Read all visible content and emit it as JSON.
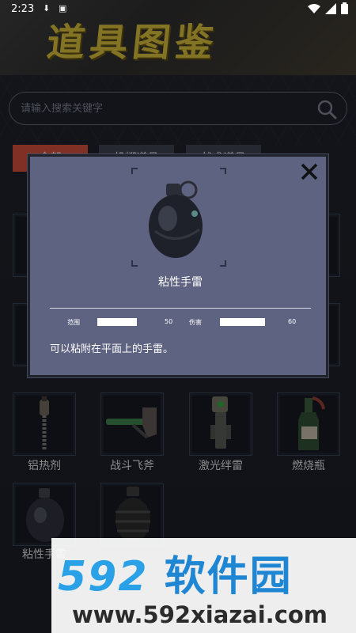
{
  "status_bar": {
    "time": "2:23"
  },
  "banner": {
    "title": "道具图鉴"
  },
  "search": {
    "placeholder": "请输入搜索关键字"
  },
  "tabs": [
    {
      "label": "全部"
    },
    {
      "label": "投掷道具"
    },
    {
      "label": "战术道具"
    }
  ],
  "grid": {
    "row3": [
      {
        "label": "铝热剂"
      },
      {
        "label": "战斗飞斧"
      },
      {
        "label": "激光绊雷"
      },
      {
        "label": "燃烧瓶"
      }
    ],
    "row4": [
      {
        "label": "粘性手雷"
      },
      {
        "label": ""
      }
    ]
  },
  "dialog": {
    "item_name": "粘性手雷",
    "stats": {
      "range_label": "范围",
      "range_value": "50",
      "damage_label": "伤害",
      "damage_value": "60",
      "range_fill": 0.5,
      "damage_fill": 0.6
    },
    "description": "可以粘附在平面上的手雷。"
  },
  "watermark": {
    "brand_number": "592",
    "brand_text": "软件园",
    "url": "www.592xiazai.com"
  },
  "colors": {
    "accent": "#c74b3b",
    "dialog_bg": "#5f6382",
    "watermark_blue": "#2aa1e6"
  }
}
